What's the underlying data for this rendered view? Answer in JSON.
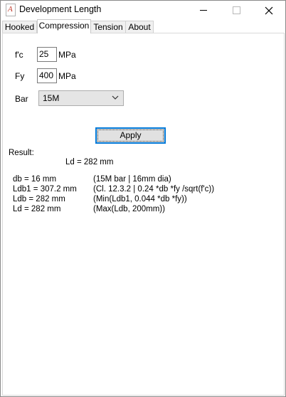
{
  "window": {
    "title": "Development Length",
    "icon": "app-icon",
    "app_icon_letter": "A"
  },
  "tabs": [
    {
      "label": "Hooked",
      "active": false
    },
    {
      "label": "Compression",
      "active": true
    },
    {
      "label": "Tension",
      "active": false
    },
    {
      "label": "About",
      "active": false
    }
  ],
  "form": {
    "fc_label": "f'c",
    "fc_value": "25",
    "fc_unit": "MPa",
    "fy_label": "Fy",
    "fy_value": "400",
    "fy_unit": "MPa",
    "bar_label": "Bar",
    "bar_value": "15M"
  },
  "apply_label": "Apply",
  "result": {
    "heading": "Result:",
    "summary": "Ld = 282 mm",
    "rows": [
      {
        "left": "db = 16 mm",
        "right": "(15M bar | 16mm dia)"
      },
      {
        "left": "Ldb1 = 307.2 mm",
        "right": "(Cl. 12.3.2 | 0.24 *db *fy /sqrt(f'c))"
      },
      {
        "left": "Ldb = 282 mm",
        "right": "(Min(Ldb1, 0.044 *db *fy))"
      },
      {
        "left": "Ld = 282 mm",
        "right": "(Max(Ldb, 200mm))"
      }
    ]
  },
  "colors": {
    "focus_border": "#0078d7",
    "button_face": "#e1e1e1",
    "combo_face": "#e5e5e5"
  }
}
